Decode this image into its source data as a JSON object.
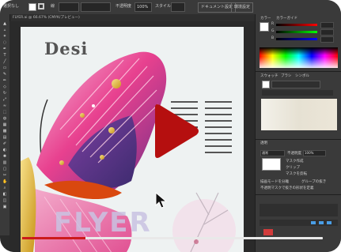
{
  "app": {
    "toolbar_selection": "選択なし",
    "stroke_label": "線",
    "stroke_weight": "",
    "opacity_label": "不透明度",
    "opacity_value": "100%",
    "style_label": "スタイル",
    "doc_settings_button": "ドキュメント設定",
    "prefs_button": "環境設定"
  },
  "document_tab": "FLYER.ai @ 66.67% (CMYK/プレビュー)",
  "artwork": {
    "logo_text": "Desi",
    "watermark_text": "FLYER"
  },
  "panel": {
    "header_tabs": [
      "カラー",
      "カラーガイド"
    ],
    "rgb_channels": [
      {
        "label": "R",
        "value": "",
        "color": "#ff4c4c"
      },
      {
        "label": "G",
        "value": "",
        "color": "#4cff4c"
      },
      {
        "label": "B",
        "value": "",
        "color": "#4c4cff"
      }
    ],
    "swatch_tabs": [
      "スウォッチ",
      "ブラシ",
      "シンボル"
    ],
    "transparency_title": "透明",
    "blend_mode": "通常",
    "opacity_label": "不透明度",
    "opacity_value": "100%",
    "make_mask_button": "マスク作成",
    "clip_option": "クリップ",
    "invert_mask_option": "マスクを反転",
    "isolate_blending": "描画モードを分離",
    "knockout_group": "グループの抜き",
    "opacity_mask_option": "不透明マスクで抜きの形状を定義"
  },
  "player": {
    "progress": 0.21,
    "accent_color": "#cc1b1b",
    "play_icon": "play-icon"
  },
  "tools": [
    "selection-tool-icon",
    "direct-selection-tool-icon",
    "magic-wand-icon",
    "lasso-icon",
    "pen-tool-icon",
    "type-tool-icon",
    "line-tool-icon",
    "rectangle-tool-icon",
    "paintbrush-icon",
    "pencil-icon",
    "eraser-icon",
    "rotate-tool-icon",
    "scale-tool-icon",
    "width-tool-icon",
    "free-transform-icon",
    "shape-builder-icon",
    "perspective-grid-icon",
    "mesh-tool-icon",
    "gradient-tool-icon",
    "eyedropper-icon",
    "blend-tool-icon",
    "symbol-sprayer-icon",
    "column-graph-icon",
    "artboard-tool-icon",
    "slice-tool-icon",
    "hand-tool-icon",
    "zoom-tool-icon",
    "fill-stroke-icon",
    "drawing-modes-icon",
    "screen-mode-icon"
  ]
}
